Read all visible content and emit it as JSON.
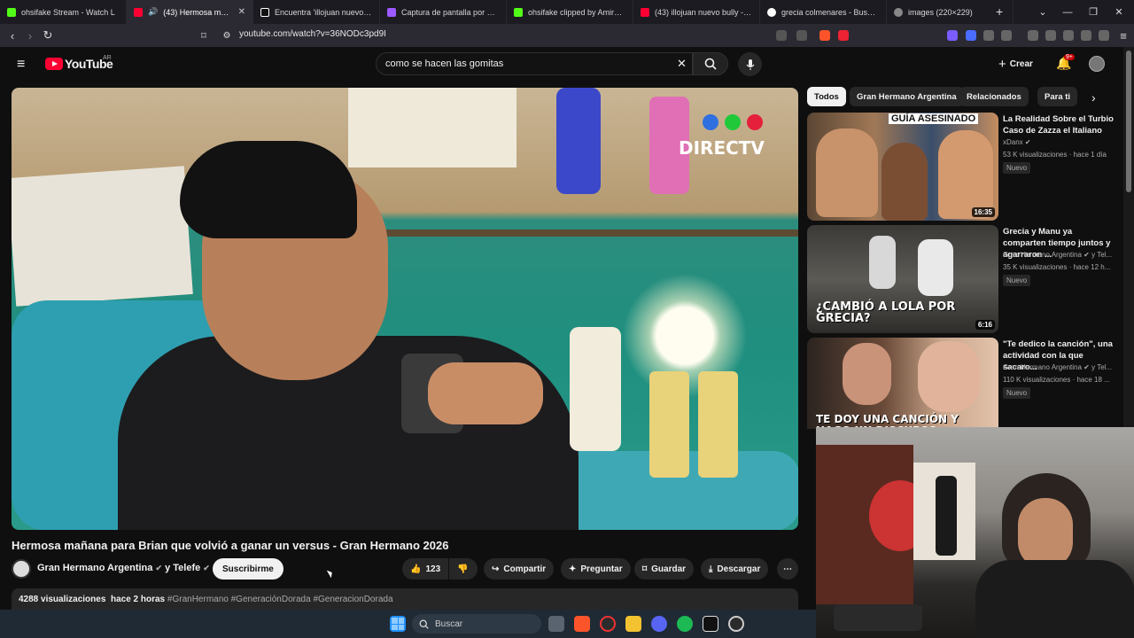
{
  "browser": {
    "tabs": [
      {
        "title": "ohsifake Stream - Watch L",
        "color": "#53fc18"
      },
      {
        "title": "(43) Hermosa mañana",
        "color": "#ff0033",
        "active": true
      },
      {
        "title": "Encuentra 'illojuan nuevo bull",
        "color": "#ffffff"
      },
      {
        "title": "Captura de pantalla por Light",
        "color": "#9b59ff"
      },
      {
        "title": "ohsifake clipped by AmirAbra",
        "color": "#53fc18"
      },
      {
        "title": "(43) illojuan nuevo bully - You",
        "color": "#ff0033"
      },
      {
        "title": "grecia colmenares - Buscar co",
        "color": "#ffffff"
      },
      {
        "title": "images (220×229)",
        "color": "#888888"
      }
    ],
    "new_tab": "+",
    "url": "youtube.com/watch?v=36NODc3pd9I"
  },
  "youtube": {
    "logo": "YouTube",
    "region": "AR",
    "search_query": "como se hacen las gomitas",
    "create_label": "Crear",
    "notif_count": "9+"
  },
  "video": {
    "title": "Hermosa mañana para Brian que volvió a ganar un versus - Gran Hermano 2026",
    "channel": "Gran Hermano Argentina",
    "channel_extra": "y Telefe",
    "subscribe_label": "Suscribirme",
    "likes": "123",
    "share_label": "Compartir",
    "ask_label": "Preguntar",
    "save_label": "Guardar",
    "download_label": "Descargar",
    "views": "4288 visualizaciones",
    "age": "hace 2 horas",
    "hashtags": "#GranHermano #GeneraciónDorada #GeneracionDorada",
    "watermark": "DIRECTV"
  },
  "sidebar": {
    "chips": [
      "Todos",
      "Gran Hermano Argentina",
      "Relacionados",
      "Para ti"
    ],
    "recommendations": [
      {
        "title": "La Realidad Sobre el Turbio Caso de Zazza el Italiano",
        "channel": "xDanx",
        "stats": "53 K visualizaciones · hace 1 día",
        "badge": "Nuevo",
        "duration": "16:35",
        "thumb_caption": "GUÍA ASESINADO"
      },
      {
        "title": "Grecia y Manu ya comparten tiempo juntos y agarraron ...",
        "channel": "Gran Hermano Argentina",
        "channel_extra": "y Tel...",
        "stats": "35 K visualizaciones · hace 12 h...",
        "badge": "Nuevo",
        "duration": "6:16",
        "thumb_caption": "¿CAMBIÓ A LOLA POR GRECIA?"
      },
      {
        "title": "\"Te dedico la canción\", una actividad con la que sacaro...",
        "channel": "Gran Hermano Argentina",
        "channel_extra": "y Tel...",
        "stats": "110 K visualizaciones · hace 18 ...",
        "badge": "Nuevo",
        "duration": "",
        "thumb_caption": "TE DOY UNA CANCIÓN Y HAGO UN DISCURSO"
      }
    ]
  },
  "taskbar": {
    "search_label": "Buscar"
  }
}
